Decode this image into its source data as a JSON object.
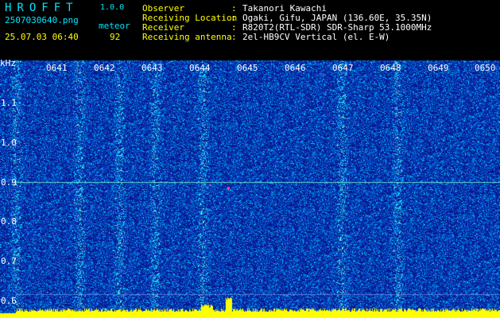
{
  "header": {
    "app_title": "HROFFT",
    "version": "1.0.0",
    "file_name": "2507030640.png",
    "mode": "meteor",
    "datetime": "25.07.03 06:40",
    "count": "92",
    "info": [
      {
        "label": "Observer",
        "value": "Takanori Kawachi"
      },
      {
        "label": "Receiving Location",
        "value": "Ogaki, Gifu, JAPAN (136.60E, 35.35N)"
      },
      {
        "label": "Receiver",
        "value": "R820T2(RTL-SDR) SDR-Sharp 53.1000MHz"
      },
      {
        "label": "Receiving antenna",
        "value": "2el-HB9CV Vertical (el. E-W)"
      }
    ],
    "separator": ":"
  },
  "axis": {
    "unit": "kHz",
    "y_ticks": [
      "1.1",
      "1.0",
      "0.9",
      "0.8",
      "0.7",
      "0.6"
    ],
    "x_ticks": [
      "0641",
      "0642",
      "0643",
      "0644",
      "0645",
      "0646",
      "0647",
      "0648",
      "0649",
      "0650"
    ]
  },
  "colors": {
    "background": "#0a1a8c",
    "header_cyan": "#00e6ff",
    "header_yellow": "#ffff00",
    "baseline_yellow": "#ffff00"
  }
}
